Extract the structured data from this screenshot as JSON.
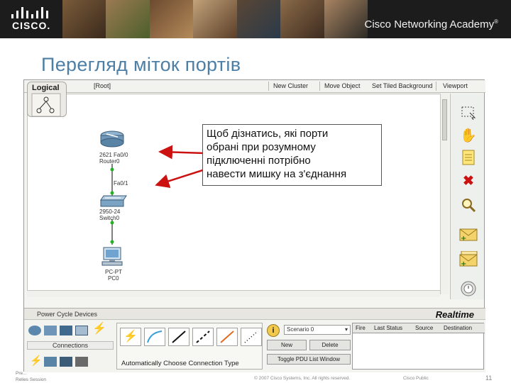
{
  "header": {
    "logo_text": "CISCO.",
    "academy_text": "Cisco Networking Academy",
    "academy_mark": "®"
  },
  "slide": {
    "title": "Перегляд міток портів"
  },
  "toolbar": {
    "logical_tab": "Logical",
    "root": "[Root]",
    "new_cluster": "New Cluster",
    "move_object": "Move Object",
    "tiled_background": "Set Tiled Background",
    "viewport": "Viewport"
  },
  "devices": {
    "router_port": "2621 Fa0/0",
    "router_name": "Router0",
    "switch_port": "Fa0/1",
    "switch_model": "2950-24",
    "switch_name": "Switch0",
    "pc_model": "PC-PT",
    "pc_name": "PC0"
  },
  "callout": {
    "lines": [
      "Щоб дізнатись, які порти",
      "обрані при розумному",
      "підключенні потрібно",
      "навести мишку на з'єднання"
    ]
  },
  "right_tools": [
    "select-icon",
    "hand-icon",
    "note-icon",
    "delete-icon",
    "inspect-icon",
    "add-simple-pdu-icon",
    "add-complex-pdu-icon"
  ],
  "bottom": {
    "power_cycle": "Power Cycle Devices",
    "realtime": "Realtime",
    "connections_label": "Connections",
    "connection_hint": "Automatically Choose Connection Type",
    "scenario": "Scenario 0",
    "new_btn": "New",
    "delete_btn": "Delete",
    "toggle_pdu": "Toggle PDU List Window",
    "pdu_columns": [
      "Fire",
      "Last Status",
      "Source",
      "Destination"
    ]
  },
  "footer": {
    "left_line1": "Pre...",
    "left_line2": "Relies Session",
    "copyright": "© 2007 Cisco Systems, Inc. All rights reserved.",
    "public": "Cisco Public",
    "page_number": "11"
  },
  "colors": {
    "title": "#4d7fa6",
    "link_green": "#22b322",
    "arrow_red": "#cc1111"
  }
}
